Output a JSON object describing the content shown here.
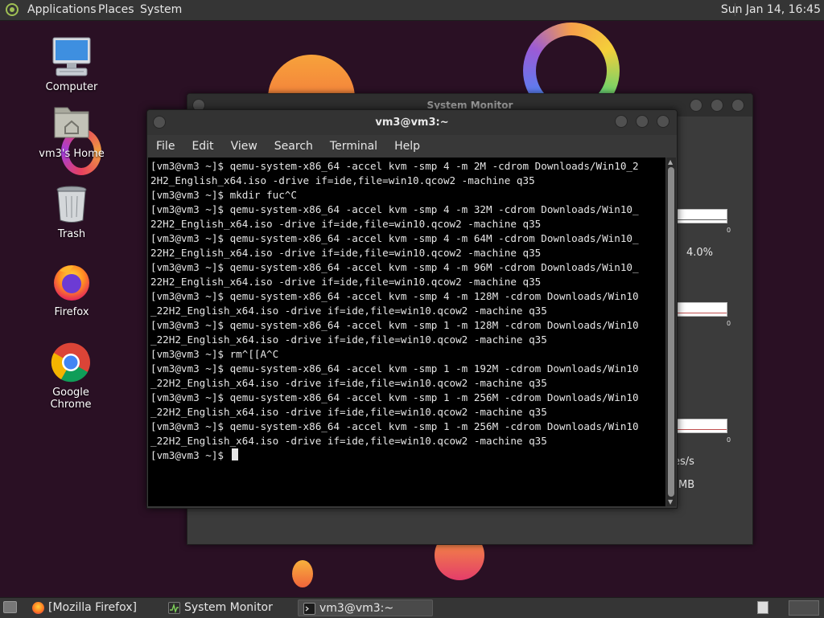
{
  "top_panel": {
    "menus": [
      "Applications",
      "Places",
      "System"
    ],
    "clock": "Sun Jan 14, 16:45"
  },
  "desktop_icons": [
    {
      "label": "Computer",
      "icon": "computer-icon"
    },
    {
      "label": "vm3's Home",
      "icon": "home-folder-icon"
    },
    {
      "label": "Trash",
      "icon": "trash-icon"
    },
    {
      "label": "Firefox",
      "icon": "firefox-icon"
    },
    {
      "label": "Google Chrome",
      "icon": "chrome-icon"
    }
  ],
  "system_monitor": {
    "title": "System Monitor",
    "cpu_value": "4.0%",
    "net_unit": "es/s",
    "mem_unit": "MB",
    "graph_zero": "0"
  },
  "terminal": {
    "title": "vm3@vm3:~",
    "menu": [
      "File",
      "Edit",
      "View",
      "Search",
      "Terminal",
      "Help"
    ],
    "lines": [
      "[vm3@vm3 ~]$ qemu-system-x86_64 -accel kvm -smp 4 -m 2M -cdrom Downloads/Win10_2",
      "2H2_English_x64.iso -drive if=ide,file=win10.qcow2 -machine q35",
      "[vm3@vm3 ~]$ mkdir fuc^C",
      "[vm3@vm3 ~]$ qemu-system-x86_64 -accel kvm -smp 4 -m 32M -cdrom Downloads/Win10_",
      "22H2_English_x64.iso -drive if=ide,file=win10.qcow2 -machine q35",
      "[vm3@vm3 ~]$ qemu-system-x86_64 -accel kvm -smp 4 -m 64M -cdrom Downloads/Win10_",
      "22H2_English_x64.iso -drive if=ide,file=win10.qcow2 -machine q35",
      "[vm3@vm3 ~]$ qemu-system-x86_64 -accel kvm -smp 4 -m 96M -cdrom Downloads/Win10_",
      "22H2_English_x64.iso -drive if=ide,file=win10.qcow2 -machine q35",
      "[vm3@vm3 ~]$ qemu-system-x86_64 -accel kvm -smp 4 -m 128M -cdrom Downloads/Win10",
      "_22H2_English_x64.iso -drive if=ide,file=win10.qcow2 -machine q35",
      "[vm3@vm3 ~]$ qemu-system-x86_64 -accel kvm -smp 1 -m 128M -cdrom Downloads/Win10",
      "_22H2_English_x64.iso -drive if=ide,file=win10.qcow2 -machine q35",
      "[vm3@vm3 ~]$ rm^[[A^C",
      "[vm3@vm3 ~]$ qemu-system-x86_64 -accel kvm -smp 1 -m 192M -cdrom Downloads/Win10",
      "_22H2_English_x64.iso -drive if=ide,file=win10.qcow2 -machine q35",
      "[vm3@vm3 ~]$ qemu-system-x86_64 -accel kvm -smp 1 -m 256M -cdrom Downloads/Win10",
      "_22H2_English_x64.iso -drive if=ide,file=win10.qcow2 -machine q35",
      "[vm3@vm3 ~]$ qemu-system-x86_64 -accel kvm -smp 1 -m 256M -cdrom Downloads/Win10",
      "_22H2_English_x64.iso -drive if=ide,file=win10.qcow2 -machine q35"
    ],
    "prompt": "[vm3@vm3 ~]$ "
  },
  "taskbar": {
    "tasks": [
      {
        "label": "[Mozilla Firefox]",
        "icon": "firefox-icon"
      },
      {
        "label": "System Monitor",
        "icon": "system-monitor-icon"
      },
      {
        "label": "vm3@vm3:~",
        "icon": "terminal-icon"
      }
    ]
  },
  "colors": {
    "desktop_bg": "#2a1024",
    "panel_bg": "#353535",
    "terminal_bg": "#000000",
    "accent_green": "#9fbf54"
  }
}
